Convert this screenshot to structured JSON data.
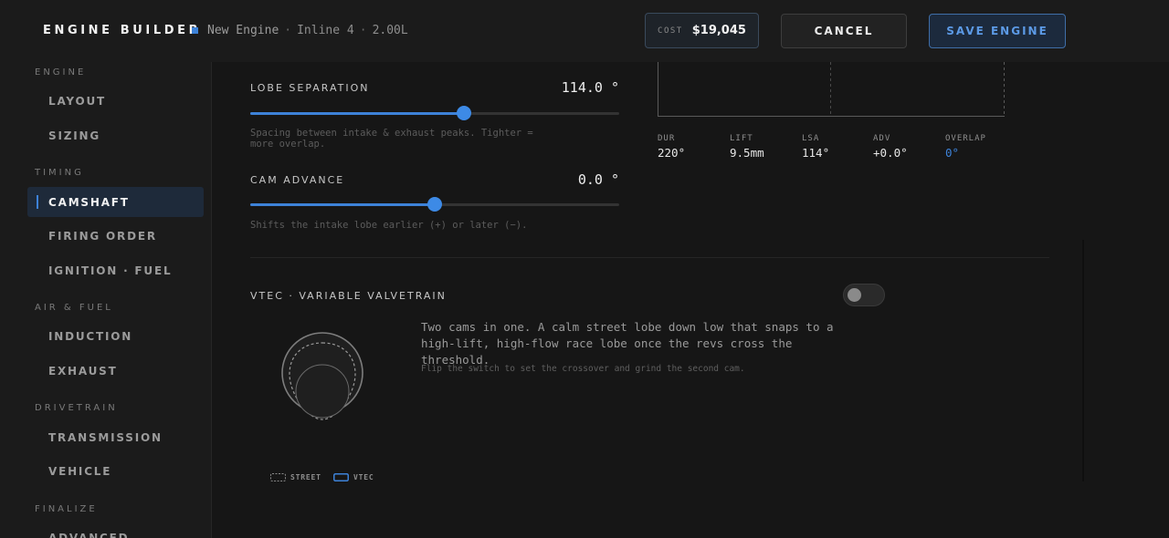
{
  "header": {
    "title": "ENGINE BUILDER",
    "engine_name": "New Engine",
    "engine_layout": "Inline 4",
    "engine_displacement": "2.00L",
    "cost_label": "COST",
    "cost_value": "$19,045",
    "cancel_label": "CANCEL",
    "save_label": "SAVE ENGINE",
    "accent_color": "#3d82d8"
  },
  "sidebar": {
    "groups": [
      {
        "label": "ENGINE",
        "items": [
          {
            "label": "LAYOUT"
          },
          {
            "label": "SIZING"
          }
        ]
      },
      {
        "label": "TIMING",
        "items": [
          {
            "label": "CAMSHAFT",
            "active": true
          },
          {
            "label": "FIRING ORDER"
          },
          {
            "label": "IGNITION · FUEL"
          }
        ]
      },
      {
        "label": "AIR & FUEL",
        "items": [
          {
            "label": "INDUCTION"
          },
          {
            "label": "EXHAUST"
          }
        ]
      },
      {
        "label": "DRIVETRAIN",
        "items": [
          {
            "label": "TRANSMISSION"
          },
          {
            "label": "VEHICLE"
          }
        ]
      },
      {
        "label": "FINALIZE",
        "items": [
          {
            "label": "ADVANCED"
          }
        ]
      }
    ]
  },
  "controls": {
    "lobe_separation": {
      "label": "LOBE SEPARATION",
      "value": "114.0 °",
      "fill_fraction": 0.58,
      "hint": "Spacing between intake & exhaust peaks. Tighter = more overlap."
    },
    "cam_advance": {
      "label": "CAM ADVANCE",
      "value": "0.0 °",
      "fill_fraction": 0.5,
      "hint": "Shifts the intake lobe earlier (+) or later (−)."
    }
  },
  "stats": [
    {
      "key": "DUR",
      "value": "220°"
    },
    {
      "key": "LIFT",
      "value": "9.5mm"
    },
    {
      "key": "LSA",
      "value": "114°"
    },
    {
      "key": "ADV",
      "value": "+0.0°"
    },
    {
      "key": "OVERLAP",
      "value": "0°",
      "highlight": true
    }
  ],
  "vtec": {
    "title": "VTEC · VARIABLE VALVETRAIN",
    "enabled": false,
    "description": "Two cams in one. A calm street lobe down low that snaps to a high-lift, high-flow race lobe once the revs cross the threshold.",
    "subtext": "Flip the switch to set the crossover and grind the second cam.",
    "legend": [
      {
        "label": "STREET",
        "icon": "dashed-box-icon"
      },
      {
        "label": "VTEC",
        "icon": "blue-box-icon"
      }
    ]
  }
}
